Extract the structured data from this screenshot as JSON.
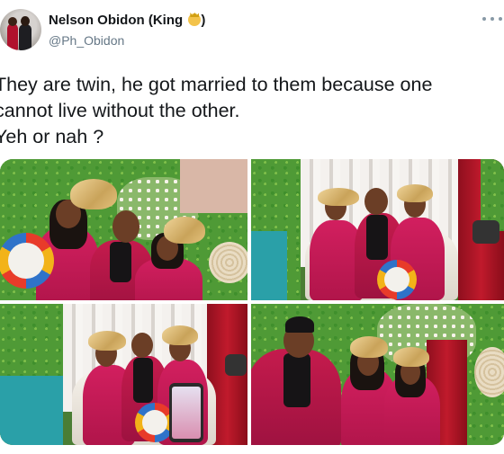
{
  "author": {
    "display_name": "Nelson Obidon (King",
    "name_suffix": ")",
    "handle": "@Ph_Obidon"
  },
  "icons": {
    "avatar": "profile-photo",
    "emoji": "king-crown-emoji",
    "menu": "more-horizontal-icon"
  },
  "tweet": {
    "lines": [
      "They are twin, he got married to them because one",
      "cannot live without the other.",
      "Yeh or nah ?"
    ]
  },
  "media": {
    "photos": [
      "wedding-photo-1",
      "wedding-photo-2",
      "wedding-photo-3",
      "wedding-photo-4"
    ]
  }
}
